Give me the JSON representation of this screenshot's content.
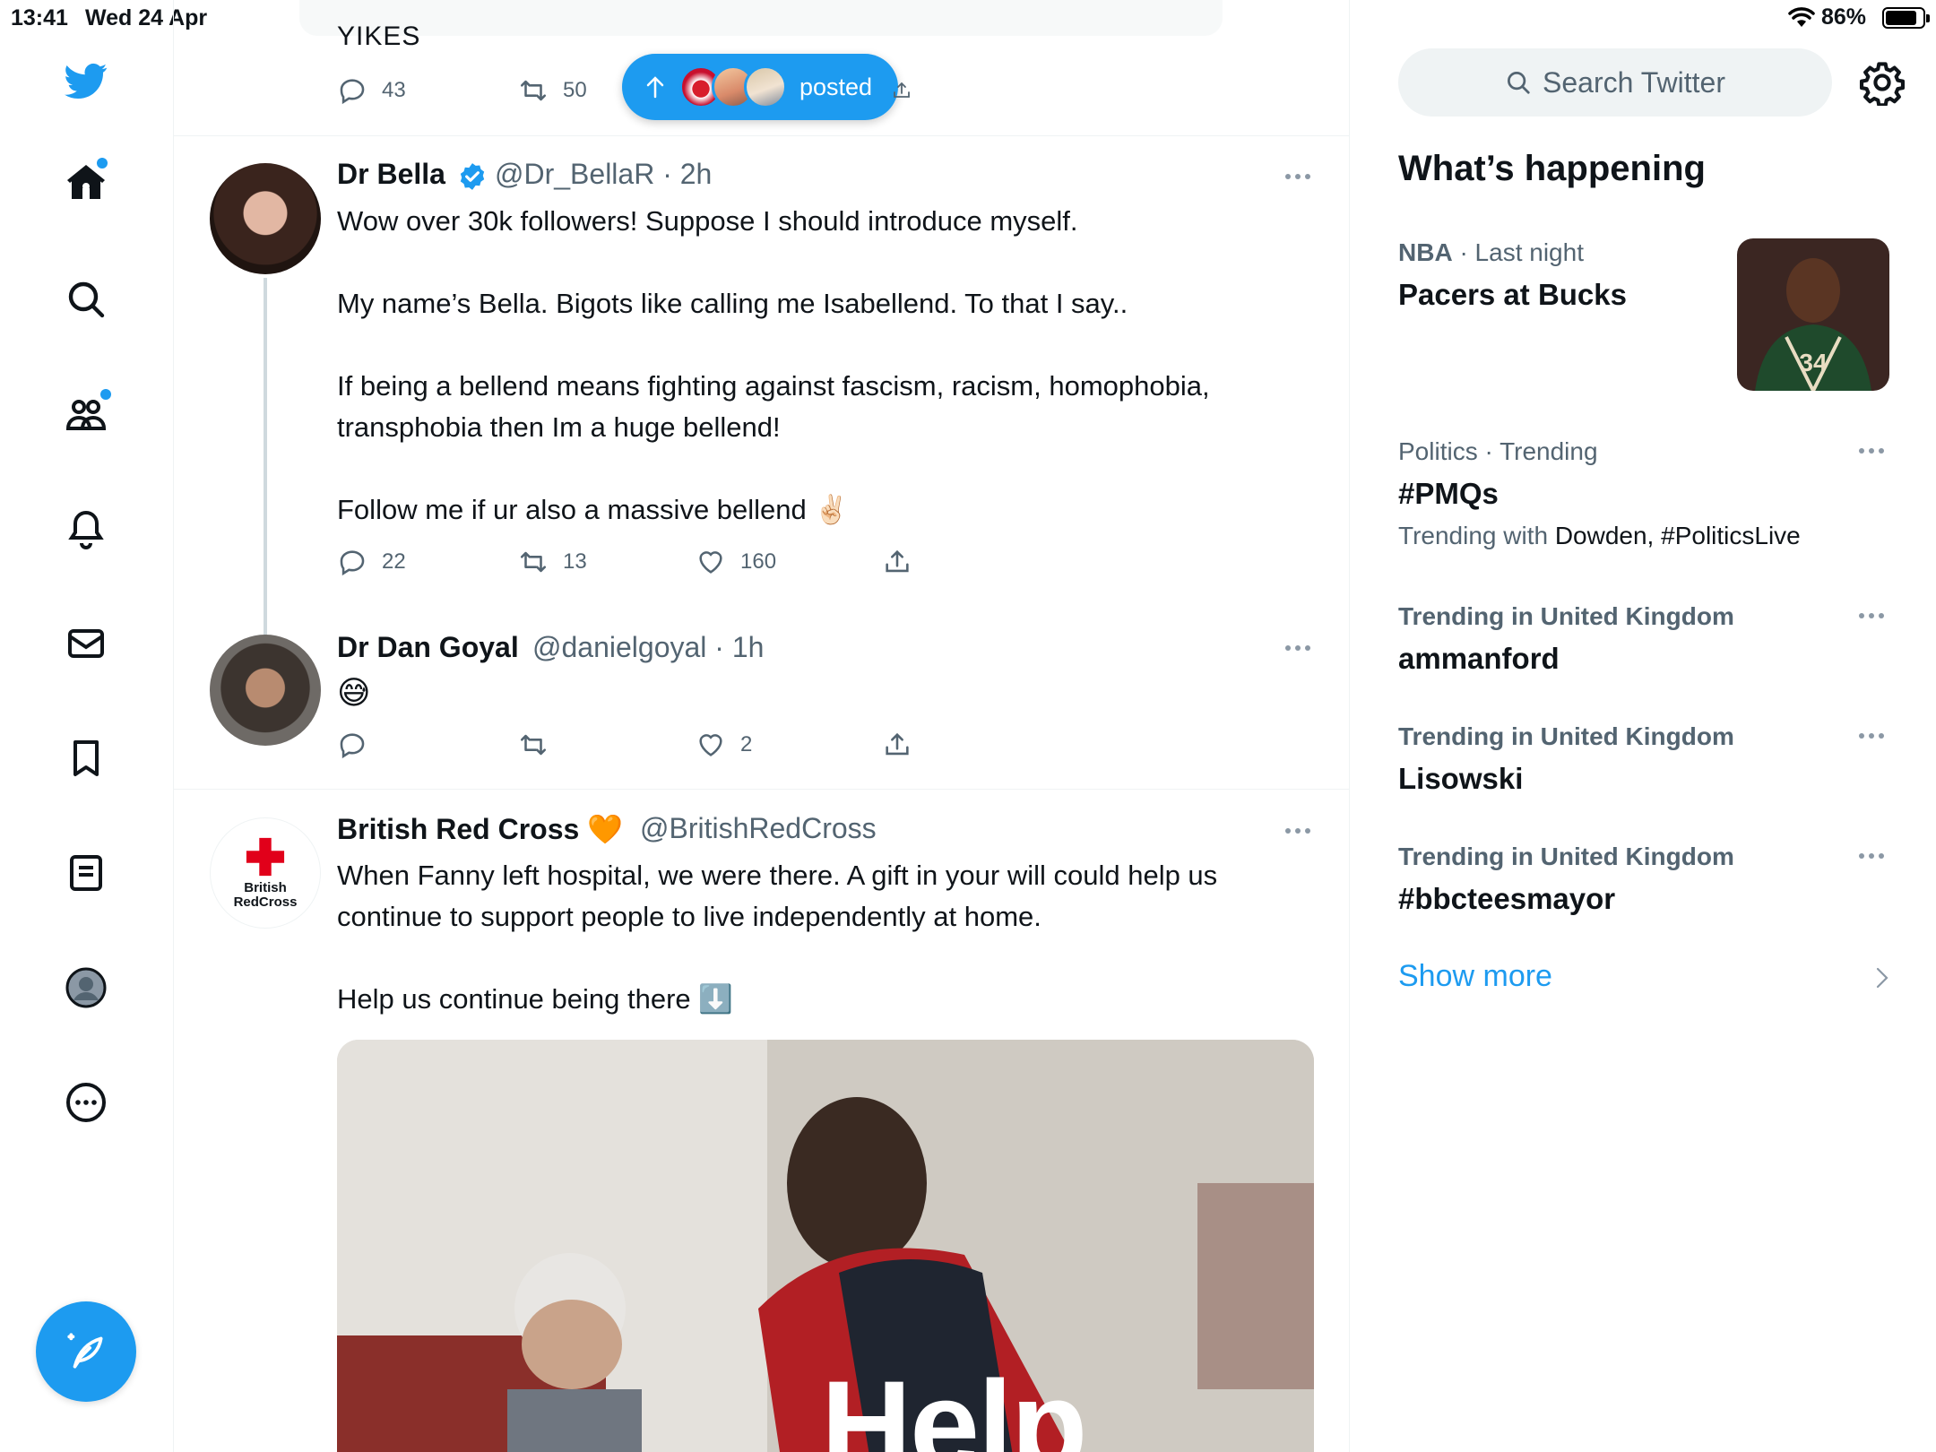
{
  "status_bar": {
    "time": "13:41",
    "date": "Wed 24 Apr",
    "battery": "86%"
  },
  "top_card": {
    "text": "YIKES",
    "reply_count": "43",
    "retweet_count": "50",
    "posted_pill": "posted"
  },
  "tweets": [
    {
      "name": "Dr Bella",
      "verified": true,
      "handle_time": "@Dr_BellaR · 2h",
      "text": "Wow over 30k followers! Suppose I should introduce myself.\n\nMy name’s Bella. Bigots like calling me Isabellend. To that I say..\n\nIf being a bellend means fighting against fascism, racism, homophobia,\ntransphobia then Im a huge bellend!\n\nFollow me if ur also a massive bellend ✌🏻",
      "replies": "22",
      "retweets": "13",
      "likes": "160"
    },
    {
      "name": "Dr Dan Goyal",
      "handle_time": "@danielgoyal · 1h",
      "text": "😅",
      "replies": "",
      "retweets": "",
      "likes": "2"
    },
    {
      "name": "British Red Cross 🧡",
      "handle_time": "@BritishRedCross",
      "avatar_text_1": "British",
      "avatar_text_2": "RedCross",
      "text": "When Fanny left hospital, we were there. A gift in your will could help us\ncontinue to support people to live independently at home.\n\nHelp us continue being there ⬇️",
      "media_text": "Help"
    }
  ],
  "right_column": {
    "search_placeholder": "Search Twitter",
    "section_title": "What’s happening",
    "trends": [
      {
        "category": "NBA",
        "meta_rest": " · Last night",
        "title": "Pacers at Bucks"
      },
      {
        "category": "Politics · Trending",
        "title": "#PMQs",
        "with_label": "Trending with ",
        "with_terms": "Dowden, #PoliticsLive"
      },
      {
        "category": "Trending in United Kingdom",
        "title": "ammanford"
      },
      {
        "category": "Trending in United Kingdom",
        "title": "Lisowski"
      },
      {
        "category": "Trending in United Kingdom",
        "title": "#bbcteesmayor"
      }
    ],
    "show_more": "Show more"
  },
  "colors": {
    "accent": "#1d9bf0",
    "text": "#0f1419",
    "muted": "#536471",
    "border": "#eff3f4"
  }
}
